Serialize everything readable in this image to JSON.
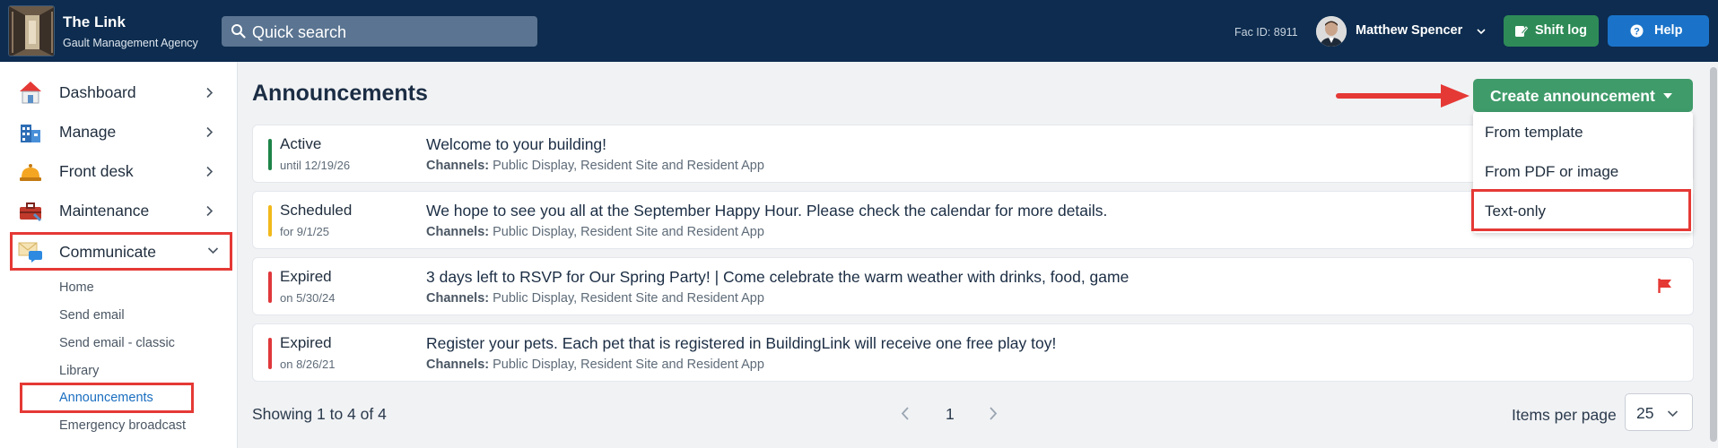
{
  "header": {
    "app_title": "The Link",
    "app_subtitle": "Gault Management Agency",
    "search_placeholder": "Quick search",
    "fac_id": "Fac ID: 8911",
    "user_name": "Matthew Spencer",
    "shift_log_label": "Shift log",
    "help_label": "Help",
    "colors": {
      "bar": "#0d2c4f",
      "shift_log": "#2e8b57",
      "help": "#1a73c9"
    }
  },
  "sidebar": {
    "items": [
      {
        "label": "Dashboard",
        "icon": "house-icon"
      },
      {
        "label": "Manage",
        "icon": "building-icon"
      },
      {
        "label": "Front desk",
        "icon": "bell-icon"
      },
      {
        "label": "Maintenance",
        "icon": "toolbox-icon"
      },
      {
        "label": "Communicate",
        "icon": "envelope-chat-icon",
        "expanded": true
      }
    ],
    "sub_items": [
      {
        "label": "Home"
      },
      {
        "label": "Send email"
      },
      {
        "label": "Send email - classic"
      },
      {
        "label": "Library"
      },
      {
        "label": "Announcements",
        "active": true
      },
      {
        "label": "Emergency broadcast"
      }
    ]
  },
  "main": {
    "title": "Announcements",
    "create_button_label": "Create announcement",
    "create_menu": [
      "From template",
      "From PDF or image",
      "Text-only"
    ],
    "channels_label": "Channels:",
    "announcements": [
      {
        "status": "Active",
        "date": "until 12/19/26",
        "status_color": "#1e8449",
        "message": "Welcome to your building!",
        "channels": "Public Display, Resident Site and Resident App",
        "flagged": false
      },
      {
        "status": "Scheduled",
        "date": "for 9/1/25",
        "status_color": "#f2b91c",
        "message": "We hope to see you all at the September Happy Hour. Please check the calendar for more details.",
        "channels": "Public Display, Resident Site and Resident App",
        "flagged": false
      },
      {
        "status": "Expired",
        "date": "on 5/30/24",
        "status_color": "#e0383b",
        "message": "3 days left to RSVP for Our Spring Party! | Come celebrate the warm weather with drinks, food, game",
        "channels": "Public Display, Resident Site and Resident App",
        "flagged": true
      },
      {
        "status": "Expired",
        "date": "on 8/26/21",
        "status_color": "#e0383b",
        "message": "Register your pets. Each pet that is registered in BuildingLink will receive one free play toy!",
        "channels": "Public Display, Resident Site and Resident App",
        "flagged": false
      }
    ],
    "pagination": {
      "showing": "Showing 1 to 4 of 4",
      "current_page": "1",
      "items_per_page_label": "Items per page",
      "items_per_page_value": "25"
    },
    "accent_color": "#3f9b6a",
    "highlight_color": "#e53935"
  }
}
